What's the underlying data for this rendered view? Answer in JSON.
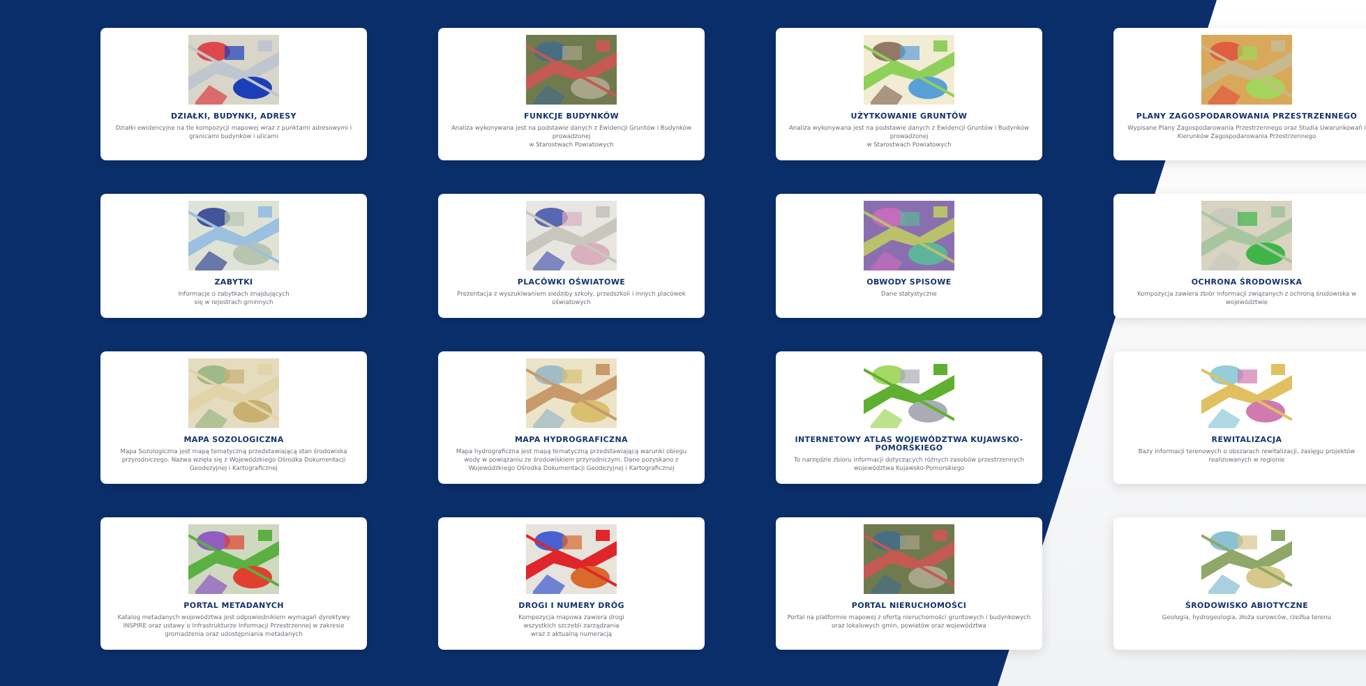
{
  "cards": [
    {
      "title": "DZIAŁKI, BUDYNKI, ADRESY",
      "description": "Działki ewidencyjne na tle kompozycji mapowej wraz z punktami adresowymi i granicami budynków i ulicami"
    },
    {
      "title": "FUNKCJE BUDYNKÓW",
      "description": "Analiza wykonywana jest na podstawie danych z Ewidencji Gruntów i Budynków prowadzonej\nw Starostwach Powiatowych"
    },
    {
      "title": "UŻYTKOWANIE GRUNTÓW",
      "description": "Analiza wykonywana jest na podstawie danych z Ewidencji Gruntów i Budynków prowadzonej\nw Starostwach Powiatowych"
    },
    {
      "title": "PLANY ZAGOSPODAROWANIA PRZESTRZENNEGO",
      "description": "Wypisane Plany Zagospodarowania Przestrzennego oraz Studia Uwarunkowań i Kierunków Zagospodarowania Przestrzennego"
    },
    {
      "title": "ZABYTKI",
      "description": "Informacje o zabytkach znajdujących\nsię w rejestrach gminnych"
    },
    {
      "title": "PLACÓWKI OŚWIATOWE",
      "description": "Prezentacja z wyszukiwaniem siedziby szkoły, przedszkoli i innych placówek oświatowych"
    },
    {
      "title": "OBWODY SPISOWE",
      "description": "Dane statystyczne"
    },
    {
      "title": "OCHRONA ŚRODOWISKA",
      "description": "Kompozycja zawiera zbiór informacji związanych z ochroną środowiska w województwie"
    },
    {
      "title": "MAPA SOZOLOGICZNA",
      "description": "Mapa Sozologiczna jest mapą tematyczną przedstawiającą stan środowiska przyrodniczego. Nazwa wzięła się z Wojewódzkiego Ośrodka Dokumentacji Geodezyjnej i Kartograficznej"
    },
    {
      "title": "MAPA HYDROGRAFICZNA",
      "description": "Mapa hydrograficzna jest mapą tematyczną przedstawiającą warunki obiegu wody w powiązaniu ze środowiskiem przyrodniczym. Dane pozyskano z Wojewódzkiego Ośrodka Dokumentacji Geodezyjnej i Kartograficznej"
    },
    {
      "title": "INTERNETOWY ATLAS WOJEWÓDZTWA KUJAWSKO-POMORSKIEGO",
      "description": "To narzędzie zbioru informacji dotyczących różnych zasobów przestrzennych województwa Kujawsko-Pomorskiego"
    },
    {
      "title": "REWITALIZACJA",
      "description": "Bazy informacji terenowych o obszarach rewitalizacji, zasięgu projektów realizowanych w regionie"
    },
    {
      "title": "PORTAL METADANYCH",
      "description": "Katalog metadanych województwa jest odpowiednikiem wymagań dyrektywy INSPIRE oraz ustawy o Infrastrukturze Informacji Przestrzennej w zakresie gromadzenia oraz udostępniania metadanych"
    },
    {
      "title": "DROGI I NUMERY DRÓG",
      "description": "Kompozycja mapowa zawiera drogi\nwszystkich szczebli zarządzania\nwraz z aktualną numeracją"
    },
    {
      "title": "PORTAL NIERUCHOMOŚCI",
      "description": "Portal na platformie mapowej z ofertą nieruchomości gruntowych i budynkowych oraz lokalowych gmin, powiatów oraz województwa"
    },
    {
      "title": "ŚRODOWISKO ABIOTYCZNE",
      "description": "Geologia, hydrogeologia, złoża surowców, rzeźba terenu"
    }
  ]
}
